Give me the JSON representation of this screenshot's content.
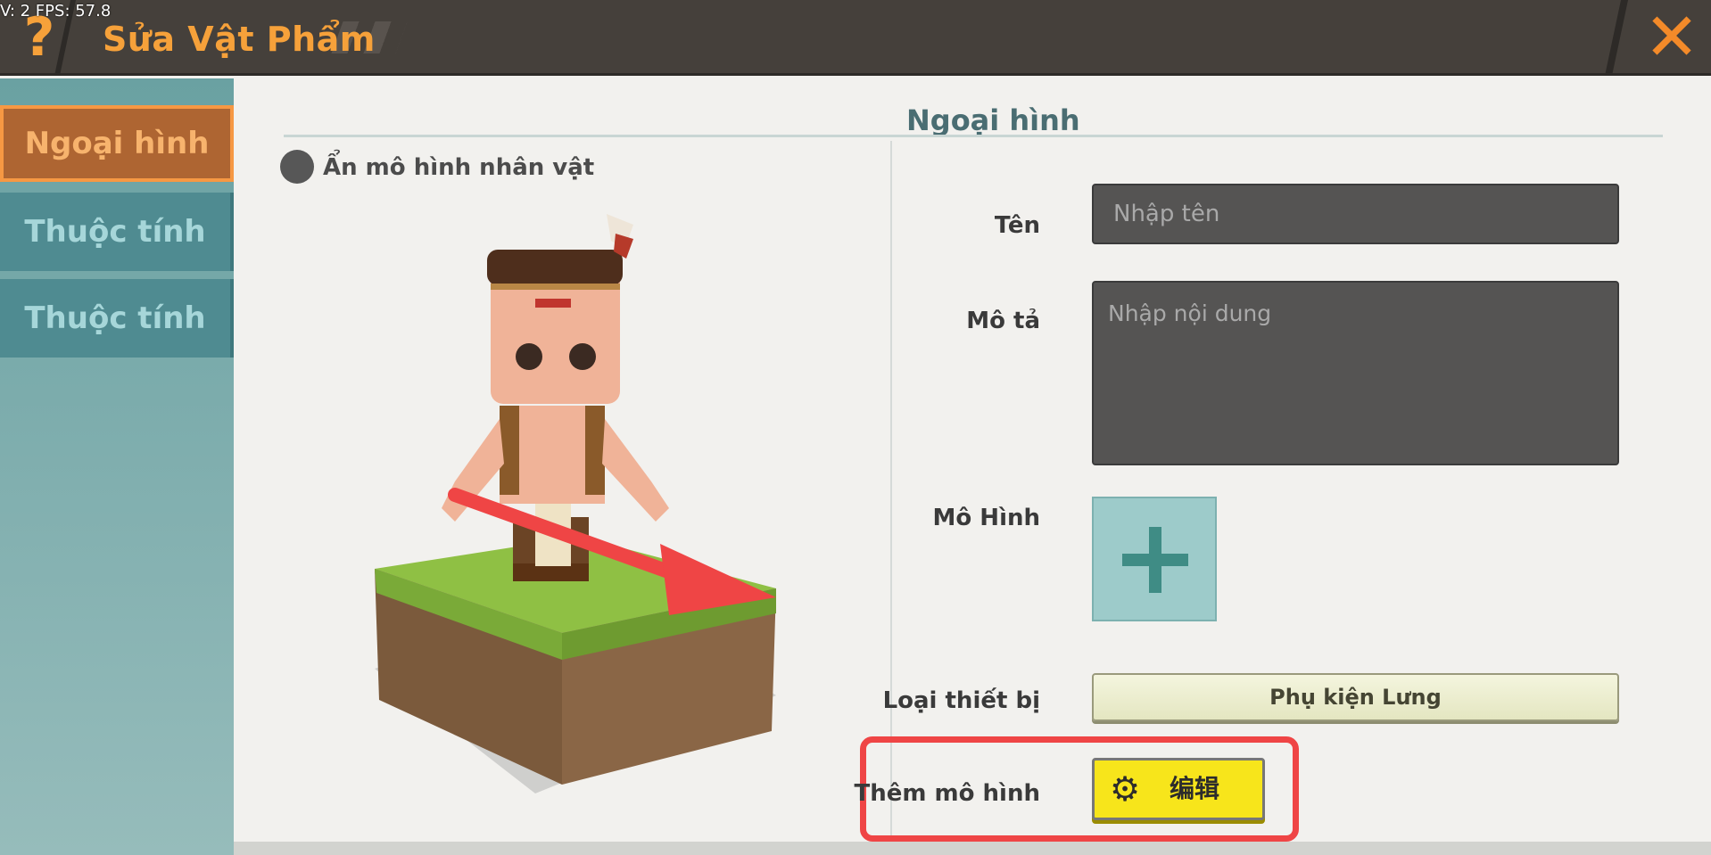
{
  "debug_overlay": "V: 2 FPS: 57.8",
  "header": {
    "title": "Sửa Vật Phẩm",
    "help_icon": "?",
    "close_icon": "✕"
  },
  "sidebar": {
    "items": [
      {
        "label": "Ngoại hình",
        "active": true
      },
      {
        "label": "Thuộc tính",
        "active": false
      },
      {
        "label": "Thuộc tính",
        "active": false
      }
    ]
  },
  "main": {
    "section_title": "Ngoại hình",
    "hide_model_label": "Ẩn mô hình nhân vật",
    "form": {
      "name_label": "Tên",
      "name_placeholder": "Nhập tên",
      "desc_label": "Mô tả",
      "desc_placeholder": "Nhập nội dung",
      "model_label": "Mô Hình",
      "equip_label": "Loại thiết bị",
      "equip_value": "Phụ kiện Lưng",
      "add_model_label": "Thêm mô hình",
      "edit_button_label": "编辑"
    }
  },
  "colors": {
    "accent_orange": "#f6a13a",
    "highlight_red": "#ef4545",
    "edit_yellow": "#f7e51b",
    "sidebar_teal": "#4f8b91"
  },
  "icons": {
    "help": "question-mark-icon",
    "close": "close-x-icon",
    "gear": "gear-icon",
    "plus": "plus-icon",
    "arrow": "red-arrow-annotation"
  }
}
